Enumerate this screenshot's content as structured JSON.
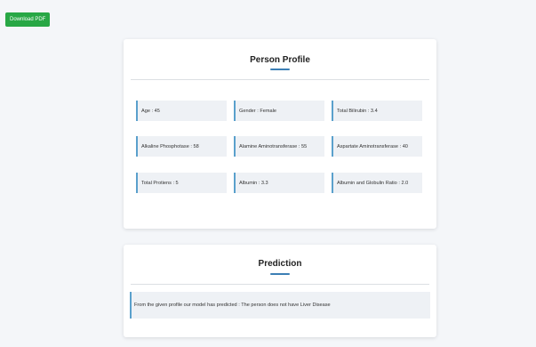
{
  "toolbar": {
    "download_label": "Download PDF"
  },
  "profile": {
    "title": "Person Profile",
    "fields": [
      "Age : 45",
      "Gender : Female",
      "Total Bilirubin : 3.4",
      "Alkaline Phosphotase : 58",
      "Alamine Aminotransferase : 55",
      "Aspartate Aminotransferase : 40",
      "Total Protiens : 5",
      "Albumin : 3.3",
      "Albumin and Globulin Ratio : 2.0"
    ]
  },
  "prediction": {
    "title": "Prediction",
    "text": "From the given profile our model has predicted : The person does not have Liver Disease"
  },
  "colors": {
    "accent": "#3c7fb5",
    "button": "#28a745",
    "field_bg": "#eef1f5"
  }
}
